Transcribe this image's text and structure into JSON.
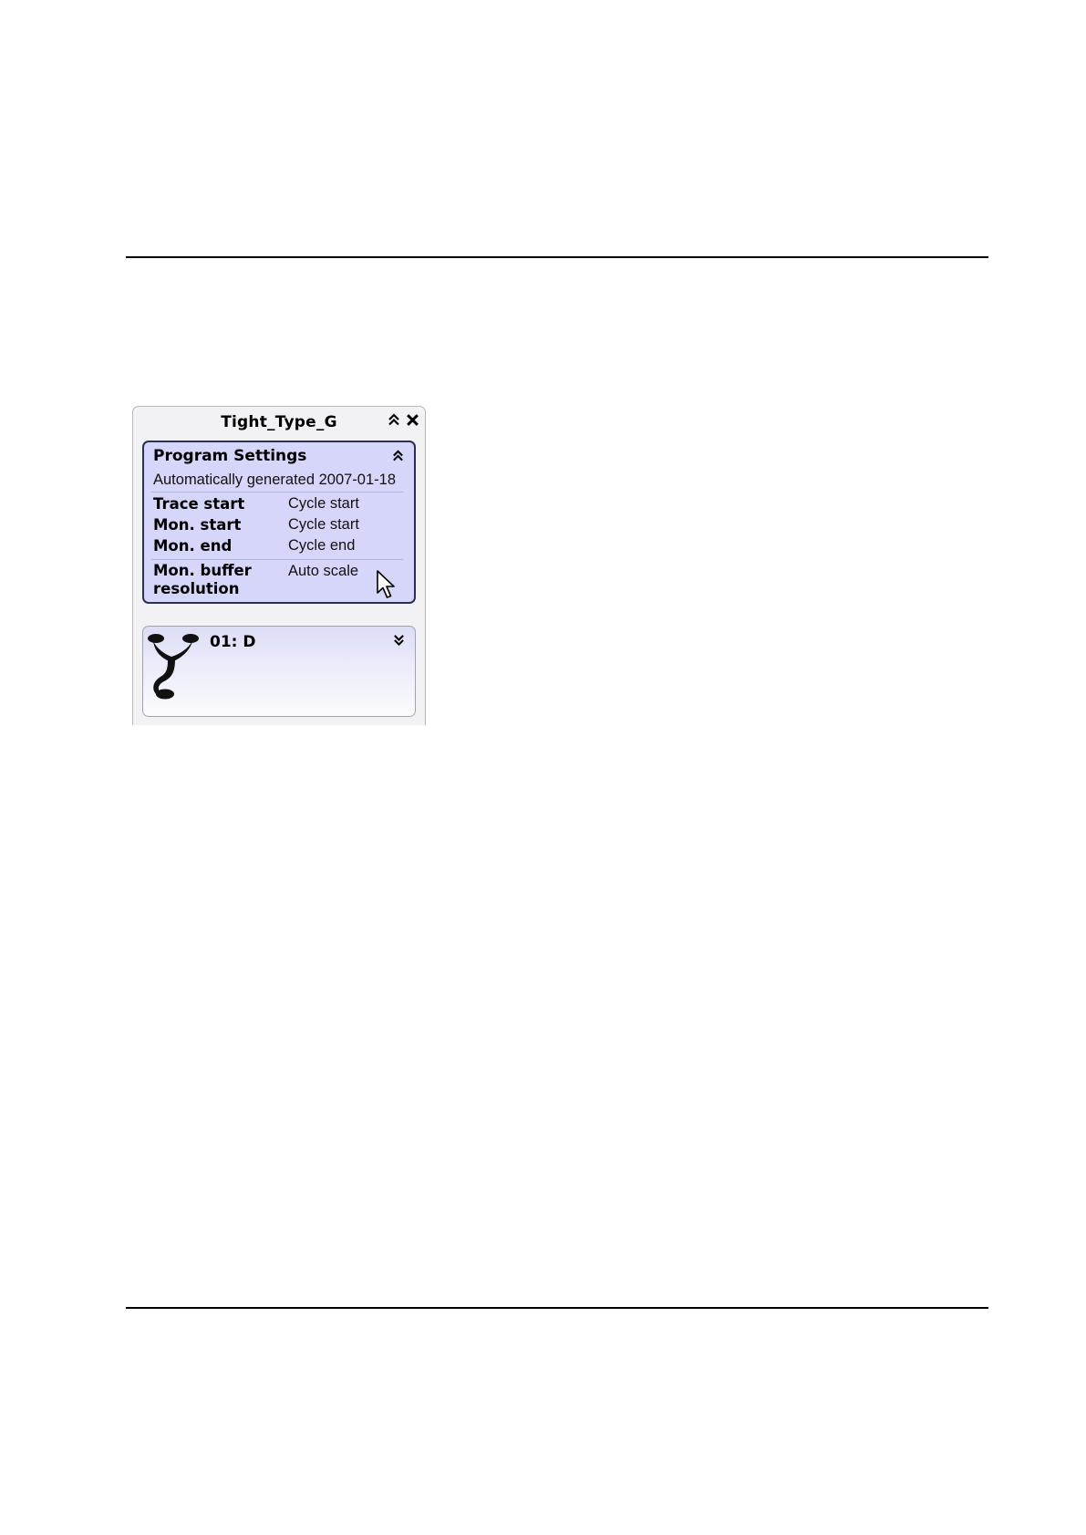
{
  "panel": {
    "title": "Tight_Type_G",
    "collapse_icon": "double-chevron-up-icon",
    "close_icon": "close-icon"
  },
  "program_settings": {
    "header": "Program Settings",
    "chevron_icon": "double-chevron-up-icon",
    "description": "Automatically generated 2007-01-18",
    "rows": [
      {
        "label": "Trace start",
        "value": "Cycle start"
      },
      {
        "label": "Mon. start",
        "value": "Cycle start"
      },
      {
        "label": "Mon. end",
        "value": "Cycle end"
      },
      {
        "label": "Mon. buffer resolution",
        "value": "Auto scale"
      }
    ]
  },
  "step": {
    "title": "01: D",
    "icon": "branch-fork-icon",
    "chevron_icon": "double-chevron-down-icon"
  },
  "cursor_icon": "mouse-pointer-icon"
}
